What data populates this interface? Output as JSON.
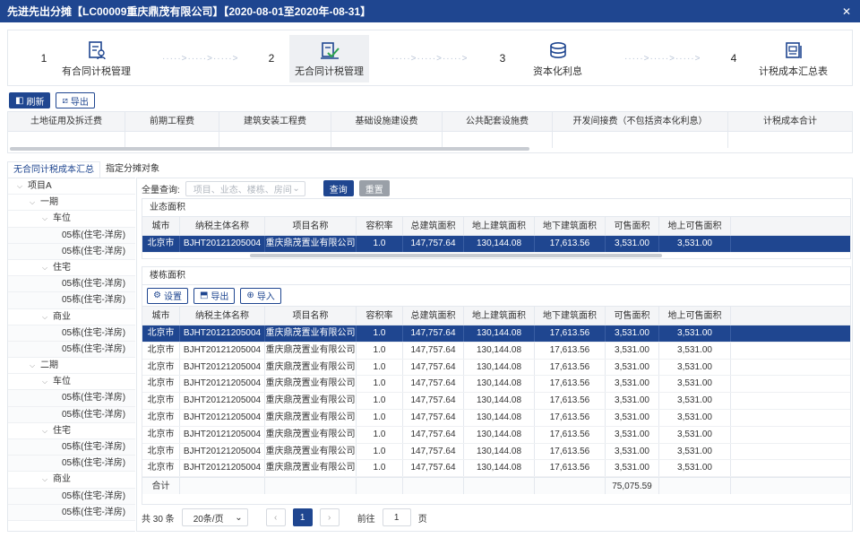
{
  "window": {
    "title": "先进先出分摊【LC00009重庆鼎茂有限公司】【2020-08-01至2020年-08-31】"
  },
  "steps": [
    {
      "num": "1",
      "label": "有合同计税管理",
      "icon": "contract-person-icon"
    },
    {
      "num": "2",
      "label": "无合同计税管理",
      "icon": "document-check-icon"
    },
    {
      "num": "3",
      "label": "资本化利息",
      "icon": "coins-icon"
    },
    {
      "num": "4",
      "label": "计税成本汇总表",
      "icon": "report-icon"
    }
  ],
  "toolbar": {
    "refresh": "刷新",
    "export": "导出"
  },
  "cost_table": {
    "headers": [
      "土地征用及拆迁费",
      "前期工程费",
      "建筑安装工程费",
      "基础设施建设费",
      "公共配套设施费",
      "开发间接费（不包括资本化利息）",
      "计税成本合计"
    ]
  },
  "tabs": [
    "无合同计税成本汇总",
    "指定分摊对象"
  ],
  "tree": [
    {
      "label": "项目A",
      "level": 0
    },
    {
      "label": "一期",
      "level": 1
    },
    {
      "label": "车位",
      "level": 2
    },
    {
      "label": "05栋(住宅-洋房)",
      "level": 3
    },
    {
      "label": "05栋(住宅-洋房)",
      "level": 3
    },
    {
      "label": "住宅",
      "level": 2
    },
    {
      "label": "05栋(住宅-洋房)",
      "level": 3
    },
    {
      "label": "05栋(住宅-洋房)",
      "level": 3
    },
    {
      "label": "商业",
      "level": 2
    },
    {
      "label": "05栋(住宅-洋房)",
      "level": 3
    },
    {
      "label": "05栋(住宅-洋房)",
      "level": 3
    },
    {
      "label": "二期",
      "level": 1
    },
    {
      "label": "车位",
      "level": 2
    },
    {
      "label": "05栋(住宅-洋房)",
      "level": 3
    },
    {
      "label": "05栋(住宅-洋房)",
      "level": 3
    },
    {
      "label": "住宅",
      "level": 2
    },
    {
      "label": "05栋(住宅-洋房)",
      "level": 3
    },
    {
      "label": "05栋(住宅-洋房)",
      "level": 3
    },
    {
      "label": "商业",
      "level": 2
    },
    {
      "label": "05栋(住宅-洋房)",
      "level": 3
    },
    {
      "label": "05栋(住宅-洋房)",
      "level": 3
    }
  ],
  "search": {
    "label": "全量查询:",
    "placeholder": "项目、业态、楼栋、房间",
    "query": "查询",
    "reset": "重置"
  },
  "grid_headers": [
    "城市",
    "纳税主体名称",
    "项目名称",
    "容积率",
    "总建筑面积",
    "地上建筑面积",
    "地下建筑面积",
    "可售面积",
    "地上可售面积"
  ],
  "format_section": {
    "title": "业态面积",
    "rows": [
      [
        "北京市",
        "BJHT20121205004",
        "重庆鼎茂置业有限公司",
        "1.0",
        "147,757.64",
        "130,144.08",
        "17,613.56",
        "3,531.00",
        "3,531.00"
      ]
    ]
  },
  "building_section": {
    "title": "楼栋面积",
    "buttons": {
      "settings": "设置",
      "export": "导出",
      "import": "导入"
    },
    "rows": [
      [
        "北京市",
        "BJHT20121205004",
        "重庆鼎茂置业有限公司",
        "1.0",
        "147,757.64",
        "130,144.08",
        "17,613.56",
        "3,531.00",
        "3,531.00"
      ],
      [
        "北京市",
        "BJHT20121205004",
        "重庆鼎茂置业有限公司",
        "1.0",
        "147,757.64",
        "130,144.08",
        "17,613.56",
        "3,531.00",
        "3,531.00"
      ],
      [
        "北京市",
        "BJHT20121205004",
        "重庆鼎茂置业有限公司",
        "1.0",
        "147,757.64",
        "130,144.08",
        "17,613.56",
        "3,531.00",
        "3,531.00"
      ],
      [
        "北京市",
        "BJHT20121205004",
        "重庆鼎茂置业有限公司",
        "1.0",
        "147,757.64",
        "130,144.08",
        "17,613.56",
        "3,531.00",
        "3,531.00"
      ],
      [
        "北京市",
        "BJHT20121205004",
        "重庆鼎茂置业有限公司",
        "1.0",
        "147,757.64",
        "130,144.08",
        "17,613.56",
        "3,531.00",
        "3,531.00"
      ],
      [
        "北京市",
        "BJHT20121205004",
        "重庆鼎茂置业有限公司",
        "1.0",
        "147,757.64",
        "130,144.08",
        "17,613.56",
        "3,531.00",
        "3,531.00"
      ],
      [
        "北京市",
        "BJHT20121205004",
        "重庆鼎茂置业有限公司",
        "1.0",
        "147,757.64",
        "130,144.08",
        "17,613.56",
        "3,531.00",
        "3,531.00"
      ],
      [
        "北京市",
        "BJHT20121205004",
        "重庆鼎茂置业有限公司",
        "1.0",
        "147,757.64",
        "130,144.08",
        "17,613.56",
        "3,531.00",
        "3,531.00"
      ],
      [
        "北京市",
        "BJHT20121205004",
        "重庆鼎茂置业有限公司",
        "1.0",
        "147,757.64",
        "130,144.08",
        "17,613.56",
        "3,531.00",
        "3,531.00"
      ]
    ],
    "sum_label": "合计",
    "sum_value": "75,075.59"
  },
  "pager": {
    "total": "共 30 条",
    "page_size": "20条/页",
    "current": "1",
    "goto_label": "前往",
    "goto_value": "1",
    "page_unit": "页"
  },
  "colors": {
    "primary": "#1f4690"
  }
}
